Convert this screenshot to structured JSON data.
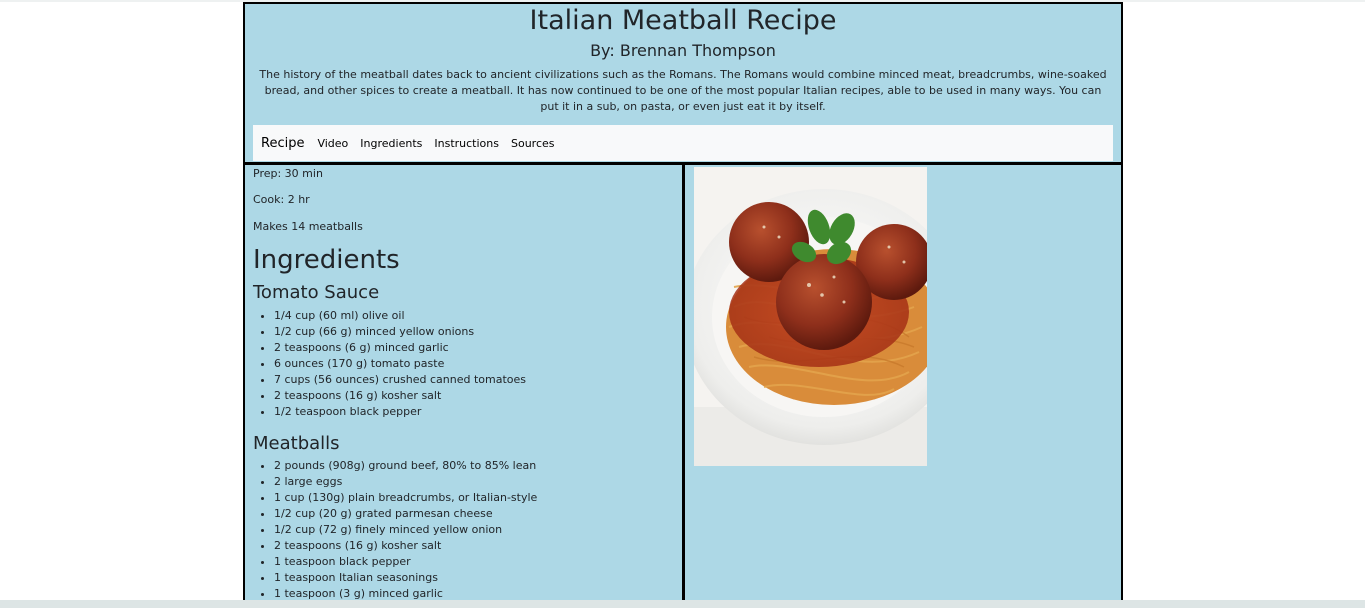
{
  "header": {
    "title": "Italian Meatball Recipe",
    "author": "By: Brennan Thompson",
    "intro": "The history of the meatball dates back to ancient civilizations such as the Romans. The Romans would combine minced meat, breadcrumbs, wine-soaked bread, and other spices to create a meatball. It has now continued to be one of the most popular Italian recipes, able to be used in many ways. You can put it in a sub, on pasta, or even just eat it by itself."
  },
  "nav": {
    "brand": "Recipe",
    "links": [
      "Video",
      "Ingredients",
      "Instructions",
      "Sources"
    ]
  },
  "info": {
    "prep": "Prep: 30 min",
    "cook": "Cook: 2 hr",
    "makes": "Makes 14 meatballs"
  },
  "ingredients": {
    "heading": "Ingredients",
    "sauce_heading": "Tomato Sauce",
    "sauce": [
      "1/4 cup (60 ml) olive oil",
      "1/2 cup (66 g) minced yellow onions",
      "2 teaspoons (6 g) minced garlic",
      "6 ounces (170 g) tomato paste",
      "7 cups (56 ounces) crushed canned tomatoes",
      "2 teaspoons (16 g) kosher salt",
      "1/2 teaspoon black pepper"
    ],
    "meatballs_heading": "Meatballs",
    "meatballs": [
      "2 pounds (908g) ground beef, 80% to 85% lean",
      "2 large eggs",
      "1 cup (130g) plain breadcrumbs, or Italian-style",
      "1/2 cup (20 g) grated parmesan cheese",
      "1/2 cup (72 g) finely minced yellow onion",
      "2 teaspoons (16 g) kosher salt",
      "1 teaspoon black pepper",
      "1 teaspoon Italian seasonings",
      "1 teaspoon (3 g) minced garlic"
    ]
  },
  "colors": {
    "panel": "#add8e6",
    "navbar": "#f8f9fa",
    "border": "#000000"
  }
}
